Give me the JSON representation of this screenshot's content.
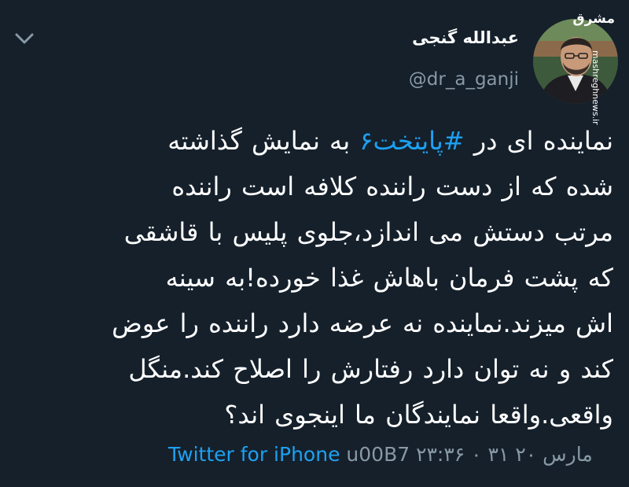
{
  "author": {
    "display_name": "عبدالله گنجی",
    "handle": "@dr_a_ganji"
  },
  "watermark": {
    "logo_text": "مشرق",
    "url_text": "mashreghnews.ir"
  },
  "tweet": {
    "line1_pre": "نماینده ای در ",
    "hashtag": "#پایتخت۶",
    "line1_post": " به نمایش گذاشته",
    "line2": "شده که از دست راننده کلافه است  راننده",
    "line3": "مرتب دستش می اندازد،جلوی پلیس با قاشقی",
    "line4": "که پشت فرمان باهاش غذا خورده!به سینه",
    "line5": "اش میزند.نماینده نه عرضه دارد راننده را عوض",
    "line6": "کند و نه توان دارد رفتارش را اصلاح کند.منگل",
    "line7": "واقعی.واقعا نمایندگان ما اینجوی اند؟"
  },
  "footer": {
    "timestamp": "۲۳:۳۶ ۰ ۳۱ مارس ۲۰",
    "separator": "u00B7",
    "source": "Twitter for iPhone"
  },
  "colors": {
    "background": "#15202b",
    "link": "#1da1f2",
    "secondary_text": "#8899a6"
  },
  "icons": {
    "menu": "chevron-down-icon"
  }
}
